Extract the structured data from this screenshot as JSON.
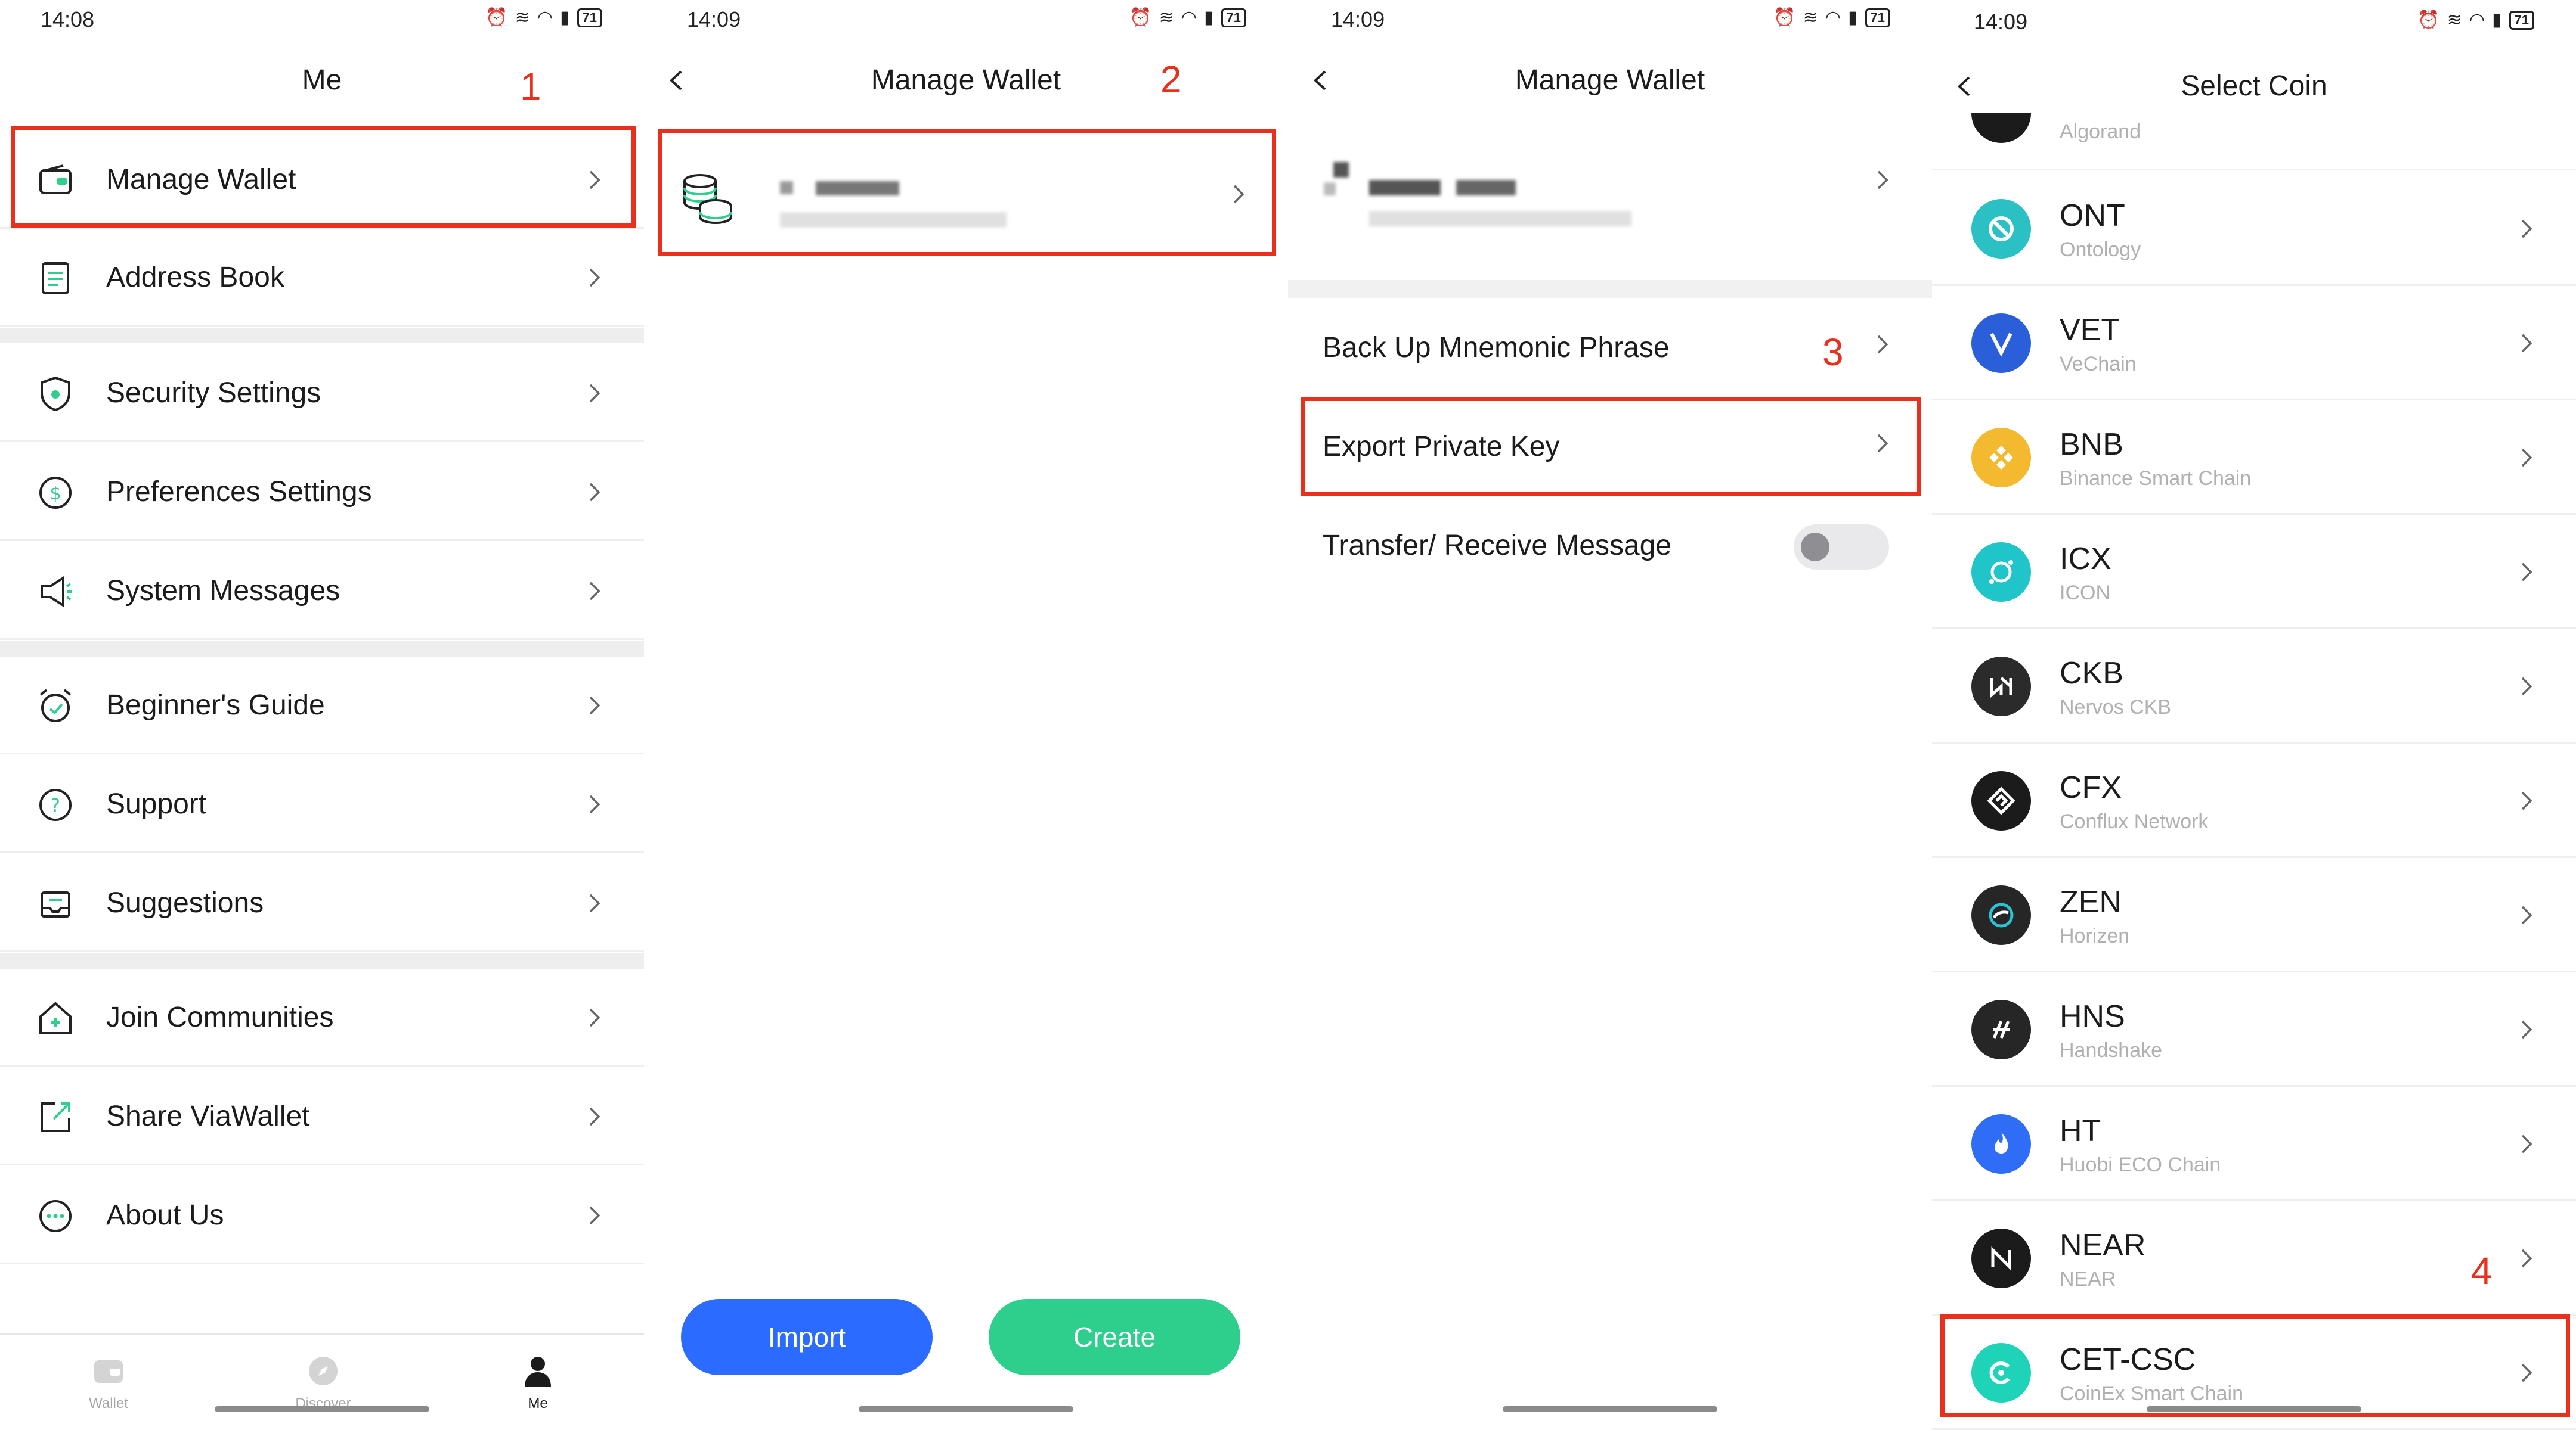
{
  "panel1": {
    "status": {
      "time": "14:08",
      "battery": "71"
    },
    "title": "Me",
    "step": "1",
    "menu": [
      {
        "label": "Manage Wallet"
      },
      {
        "label": "Address Book"
      },
      {
        "label": "Security Settings"
      },
      {
        "label": "Preferences Settings"
      },
      {
        "label": "System Messages"
      },
      {
        "label": "Beginner's Guide"
      },
      {
        "label": "Support"
      },
      {
        "label": "Suggestions"
      },
      {
        "label": "Join Communities"
      },
      {
        "label": "Share ViaWallet"
      },
      {
        "label": "About Us"
      }
    ],
    "nav": {
      "wallet": "Wallet",
      "discover": "Discover",
      "me": "Me"
    }
  },
  "panel2": {
    "status": {
      "time": "14:09",
      "battery": "71"
    },
    "title": "Manage Wallet",
    "step": "2",
    "import_label": "Import",
    "create_label": "Create"
  },
  "panel3": {
    "status": {
      "time": "14:09",
      "battery": "71"
    },
    "title": "Manage Wallet",
    "step": "3",
    "options": {
      "backup": "Back Up Mnemonic Phrase",
      "export": "Export Private Key",
      "transfer": "Transfer/ Receive Message"
    }
  },
  "panel4": {
    "status": {
      "time": "14:09",
      "battery": "71"
    },
    "title": "Select Coin",
    "step": "4",
    "partial_coin": "Algorand",
    "coins": [
      {
        "symbol": "ONT",
        "name": "Ontology",
        "color": "#2bc1c4"
      },
      {
        "symbol": "VET",
        "name": "VeChain",
        "color": "#2b5fd9"
      },
      {
        "symbol": "BNB",
        "name": "Binance Smart Chain",
        "color": "#f3ba2f"
      },
      {
        "symbol": "ICX",
        "name": "ICON",
        "color": "#1fc5c9"
      },
      {
        "symbol": "CKB",
        "name": "Nervos CKB",
        "color": "#2b2b2b"
      },
      {
        "symbol": "CFX",
        "name": "Conflux Network",
        "color": "#1b1b1b"
      },
      {
        "symbol": "ZEN",
        "name": "Horizen",
        "color": "#262626"
      },
      {
        "symbol": "HNS",
        "name": "Handshake",
        "color": "#262626"
      },
      {
        "symbol": "HT",
        "name": "Huobi ECO Chain",
        "color": "#2f6df6"
      },
      {
        "symbol": "NEAR",
        "name": "NEAR",
        "color": "#1b1b1b"
      },
      {
        "symbol": "CET-CSC",
        "name": "CoinEx Smart Chain",
        "color": "#1fd3b9"
      }
    ]
  }
}
